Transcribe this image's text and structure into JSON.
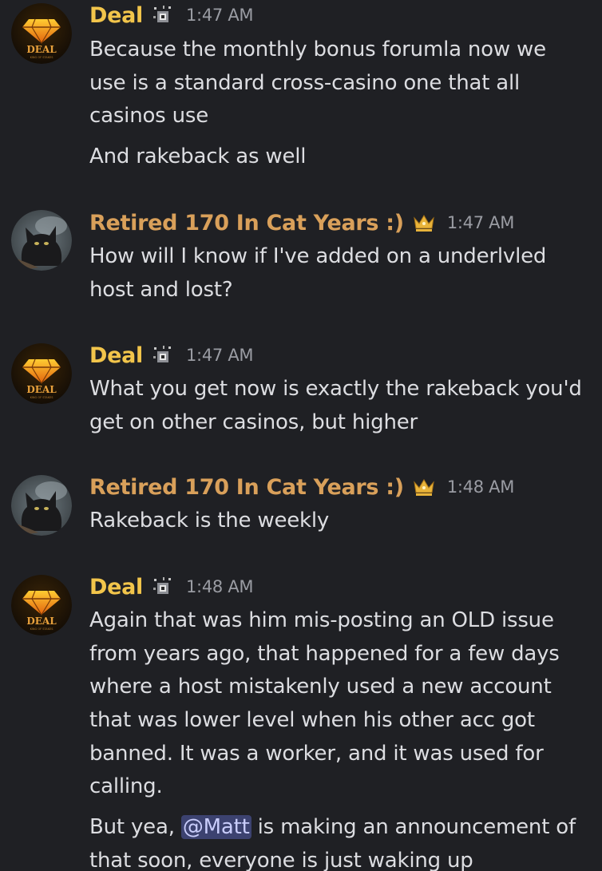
{
  "users": {
    "deal": {
      "name": "Deal",
      "color": "#f2c54b",
      "avatar_text": "DEAL",
      "avatar_subtext": "KING OF STAKES"
    },
    "retired": {
      "name": "Retired 170 In Cat Years :)",
      "color": "#d9a05a"
    }
  },
  "messages": [
    {
      "author": "Deal",
      "timestamp": "1:47 AM",
      "lines": [
        "Because the monthly bonus forumla now we",
        "use is a standard cross-casino one that all",
        "casinos use"
      ],
      "followup": [
        "And rakeback as well"
      ]
    },
    {
      "author": "Retired 170 In Cat Years :)",
      "timestamp": "1:47 AM",
      "lines": [
        "How will I know if I've added on a underlvled",
        "host and lost?"
      ]
    },
    {
      "author": "Deal",
      "timestamp": "1:47 AM",
      "lines": [
        "What you get now is exactly the rakeback you'd",
        "get on other casinos, but higher"
      ]
    },
    {
      "author": "Retired 170 In Cat Years :)",
      "timestamp": "1:48 AM",
      "lines": [
        "Rakeback is the weekly"
      ]
    },
    {
      "author": "Deal",
      "timestamp": "1:48 AM",
      "lines": [
        "Again that was him mis-posting an OLD issue",
        "from years ago, that happened for a few days",
        "where a host mistakenly used a new account",
        "that was lower level when his other acc got",
        "banned. It was a worker, and it was used for",
        "calling."
      ],
      "followup_parts": {
        "before": "But yea, ",
        "mention": "@Matt",
        "after": " is making an announcement of",
        "line2": "that soon, everyone is just waking up"
      }
    }
  ]
}
